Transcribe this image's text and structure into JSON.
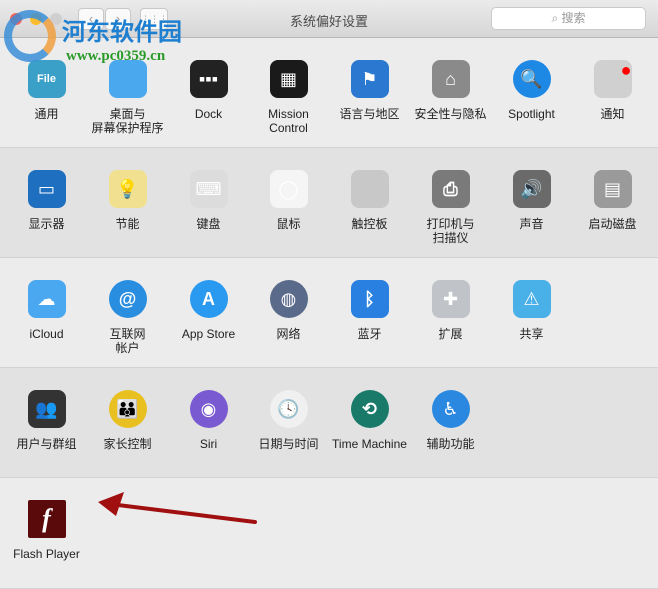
{
  "window": {
    "title": "系统偏好设置",
    "search_placeholder": "搜索",
    "back": "‹",
    "forward": "›",
    "grid": "⋮⋮⋮"
  },
  "watermark": {
    "name": "河东软件园",
    "url": "www.pc0359.cn"
  },
  "sections": [
    {
      "items": [
        {
          "id": "general",
          "label": "通用",
          "color": "#3aa0c8",
          "glyph": "File"
        },
        {
          "id": "desktop",
          "label": "桌面与\n屏幕保护程序",
          "color": "#4aa8ee",
          "glyph": ""
        },
        {
          "id": "dock",
          "label": "Dock",
          "color": "#222222",
          "glyph": "▪▪▪"
        },
        {
          "id": "mission-control",
          "label": "Mission\nControl",
          "color": "#1a1a1a",
          "glyph": "▦"
        },
        {
          "id": "language",
          "label": "语言与地区",
          "color": "#2a78d0",
          "glyph": "⚑"
        },
        {
          "id": "security",
          "label": "安全性与隐私",
          "color": "#8a8a8a",
          "glyph": "⌂"
        },
        {
          "id": "spotlight",
          "label": "Spotlight",
          "color": "#1e88e5",
          "glyph": "🔍"
        },
        {
          "id": "notifications",
          "label": "通知",
          "color": "#d0d0d0",
          "glyph": "●"
        }
      ]
    },
    {
      "items": [
        {
          "id": "displays",
          "label": "显示器",
          "color": "#1f6fc0",
          "glyph": "▭"
        },
        {
          "id": "energy",
          "label": "节能",
          "color": "#f0e090",
          "glyph": "💡"
        },
        {
          "id": "keyboard",
          "label": "键盘",
          "color": "#dcdcdc",
          "glyph": "⌨"
        },
        {
          "id": "mouse",
          "label": "鼠标",
          "color": "#f5f5f5",
          "glyph": "◯"
        },
        {
          "id": "trackpad",
          "label": "触控板",
          "color": "#c8c8c8",
          "glyph": ""
        },
        {
          "id": "printers",
          "label": "打印机与\n扫描仪",
          "color": "#7a7a7a",
          "glyph": "⎙"
        },
        {
          "id": "sound",
          "label": "声音",
          "color": "#6a6a6a",
          "glyph": "🔊"
        },
        {
          "id": "startup-disk",
          "label": "启动磁盘",
          "color": "#9a9a9a",
          "glyph": "▤"
        }
      ]
    },
    {
      "items": [
        {
          "id": "icloud",
          "label": "iCloud",
          "color": "#4aa8f0",
          "glyph": "☁"
        },
        {
          "id": "internet-accounts",
          "label": "互联网\n帐户",
          "color": "#2a8ee0",
          "glyph": "@"
        },
        {
          "id": "app-store",
          "label": "App Store",
          "color": "#2a9af0",
          "glyph": "A"
        },
        {
          "id": "network",
          "label": "网络",
          "color": "#5a6a8a",
          "glyph": "◍"
        },
        {
          "id": "bluetooth",
          "label": "蓝牙",
          "color": "#2a80e0",
          "glyph": "ᛒ"
        },
        {
          "id": "extensions",
          "label": "扩展",
          "color": "#c0c4c8",
          "glyph": "✚"
        },
        {
          "id": "sharing",
          "label": "共享",
          "color": "#4ab0e8",
          "glyph": "⚠"
        }
      ]
    },
    {
      "items": [
        {
          "id": "users-groups",
          "label": "用户与群组",
          "color": "#333333",
          "glyph": "👥"
        },
        {
          "id": "parental-controls",
          "label": "家长控制",
          "color": "#e8c020",
          "glyph": "👪"
        },
        {
          "id": "siri",
          "label": "Siri",
          "color": "#7a5ad0",
          "glyph": "◉"
        },
        {
          "id": "date-time",
          "label": "日期与时间",
          "color": "#f0f0f0",
          "glyph": "🕓"
        },
        {
          "id": "time-machine",
          "label": "Time Machine",
          "color": "#1a7a6a",
          "glyph": "⟲"
        },
        {
          "id": "accessibility",
          "label": "辅助功能",
          "color": "#2a88e0",
          "glyph": "♿"
        }
      ]
    },
    {
      "items": [
        {
          "id": "flash-player",
          "label": "Flash Player",
          "color": "#5a0a0a",
          "glyph": "f"
        }
      ]
    }
  ]
}
